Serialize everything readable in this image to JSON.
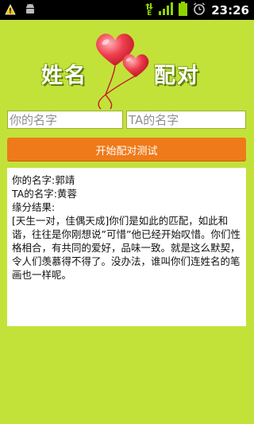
{
  "status_bar": {
    "time": "23:26",
    "network": "E",
    "icons": [
      "notification-warning-icon",
      "android-debug-icon",
      "data-arrows-icon",
      "signal-icon",
      "battery-icon",
      "alarm-icon"
    ]
  },
  "header": {
    "title_left": "姓名",
    "title_right": "配对",
    "logo_icon": "hearts-balloon-icon"
  },
  "form": {
    "name_a_placeholder": "你的名字",
    "name_b_placeholder": "TA的名字",
    "start_label": "开始配对测试"
  },
  "result": {
    "line_your_name": "你的名字:郭靖",
    "line_ta_name": "TA的名字:黄蓉",
    "line_header": "缘分结果:",
    "description": "[天生一对，佳偶天成]你们是如此的匹配，如此和谐，往往是你刚想说”可惜”他已经开始叹惜。你们性格相合，有共同的爱好，品味一致。就是这么默契，令人们羡慕得不得了。没办法，谁叫你们连姓名的笔画也一样呢。"
  },
  "colors": {
    "background": "#c2e23a",
    "button": "#ef7a1a",
    "heart": "#e8313f"
  }
}
